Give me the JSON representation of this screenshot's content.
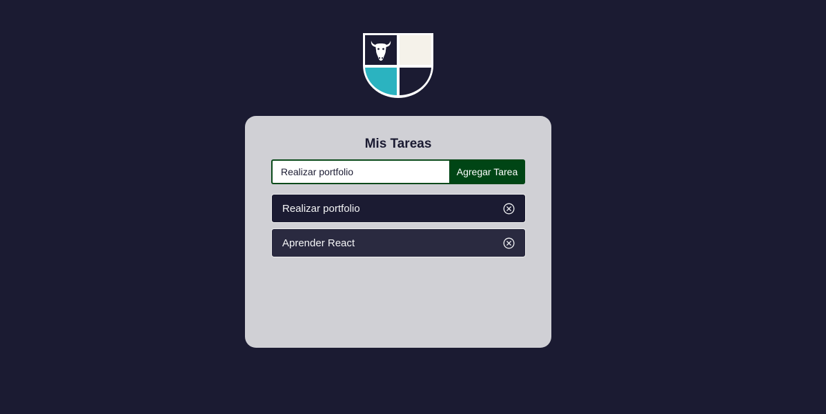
{
  "logo": {
    "icon": "bull-shield-icon",
    "colors": {
      "dark": "#1b1b32",
      "cream": "#f5f2ea",
      "teal": "#2bb3c0"
    }
  },
  "app": {
    "title": "Mis Tareas"
  },
  "form": {
    "input_value": "Realizar portfolio",
    "add_button_label": "Agregar Tarea"
  },
  "tasks": [
    {
      "text": "Realizar portfolio",
      "delete_icon": "close-circle-icon"
    },
    {
      "text": "Aprender React",
      "delete_icon": "close-circle-icon"
    }
  ],
  "colors": {
    "background": "#1b1b32",
    "card": "#d0d0d5",
    "button": "#004515"
  }
}
